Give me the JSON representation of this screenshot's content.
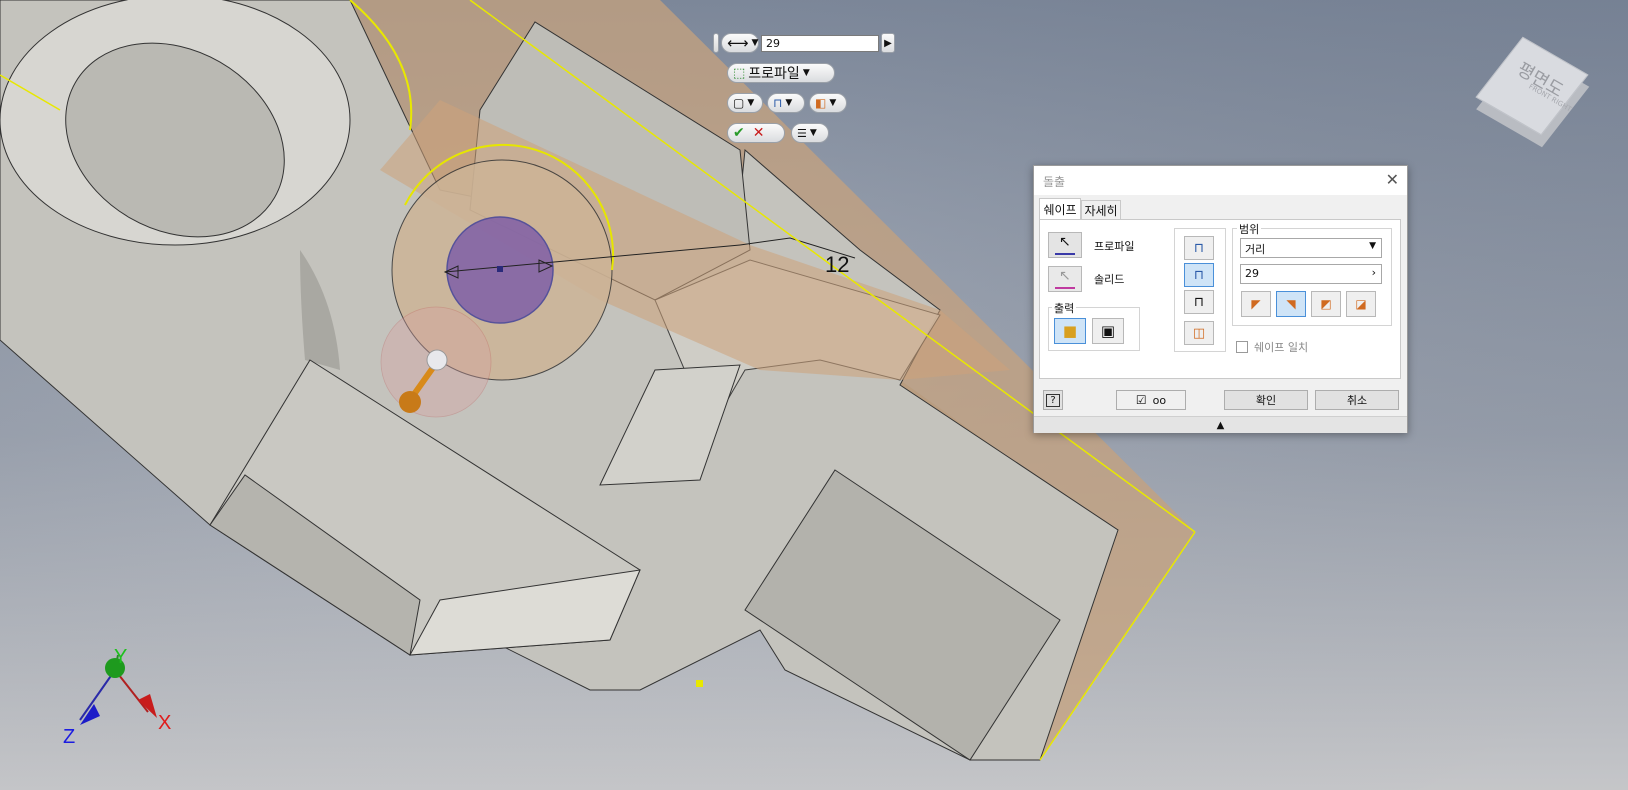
{
  "dimension_label": "12",
  "mini_toolbar": {
    "distance_value": "29",
    "profile_label": "프로파일"
  },
  "view_cube": {
    "face_label": "평면도",
    "sub_label": "FRONT RIGHT"
  },
  "axis_triad": {
    "x": "X",
    "y": "Y",
    "z": "Z"
  },
  "dialog": {
    "title": "돌출",
    "close_glyph": "✕",
    "tabs": [
      "쉐이프",
      "자세히"
    ],
    "profile_label": "프로파일",
    "solid_label": "솔리드",
    "output_title": "출력",
    "extent_title": "범위",
    "extent_type": "거리",
    "extent_value": "29",
    "match_shape_label": "쉐이프 일치",
    "help_label": "?",
    "ok_label": "확인",
    "cancel_label": "취소",
    "expand_glyph": "▲"
  },
  "colors": {
    "accent": "#4a90d9",
    "sketch_highlight": "#ffff00",
    "preview_fill": "#d9a574",
    "profile_fill": "#7b5aa8"
  }
}
